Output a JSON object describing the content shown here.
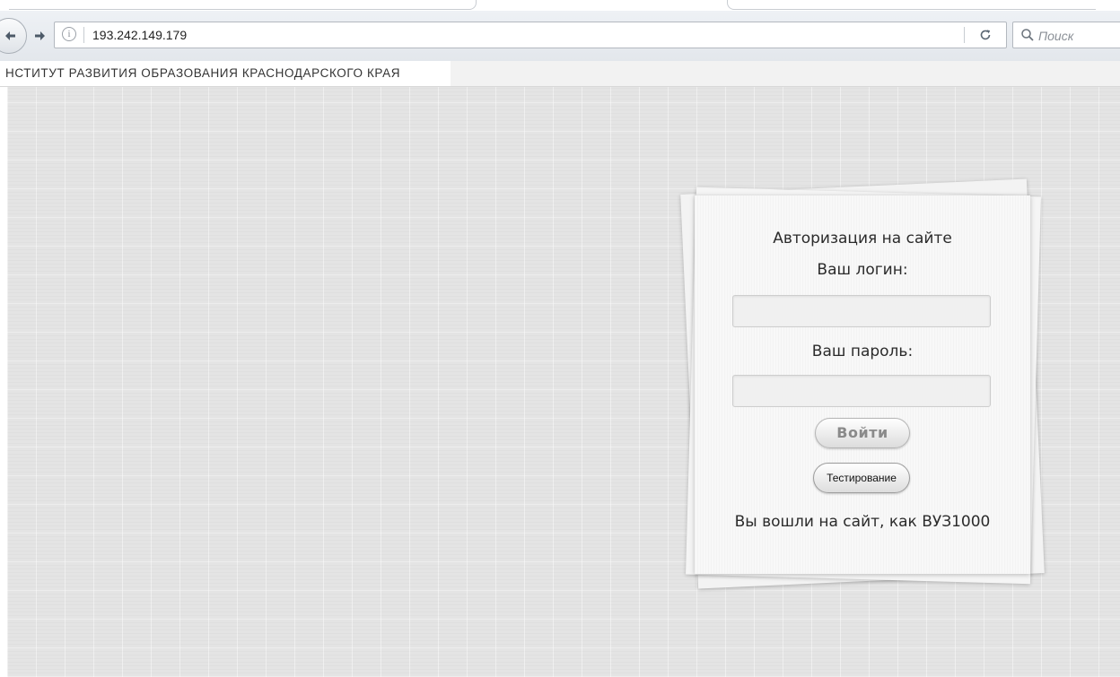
{
  "browser": {
    "url": "193.242.149.179",
    "search_placeholder": "Поиск"
  },
  "site": {
    "header_title": "НСТИТУТ РАЗВИТИЯ ОБРАЗОВАНИЯ КРАСНОДАРСКОГО КРАЯ"
  },
  "login_card": {
    "title": "Авторизация на сайте",
    "login_label": "Ваш логин:",
    "login_value": "",
    "password_label": "Ваш пароль:",
    "password_value": "",
    "login_button": "Войти",
    "test_button": "Тестирование",
    "status": "Вы вошли на сайт, как ВУЗ1000"
  },
  "icons": {
    "back": "back-arrow-icon",
    "forward": "forward-arrow-icon",
    "info": "info-icon",
    "reload": "reload-icon",
    "search": "search-icon"
  },
  "colors": {
    "page_background": "#e4e4e4",
    "card_background": "#f8f8f8",
    "toolbar": "#e8ebef"
  }
}
